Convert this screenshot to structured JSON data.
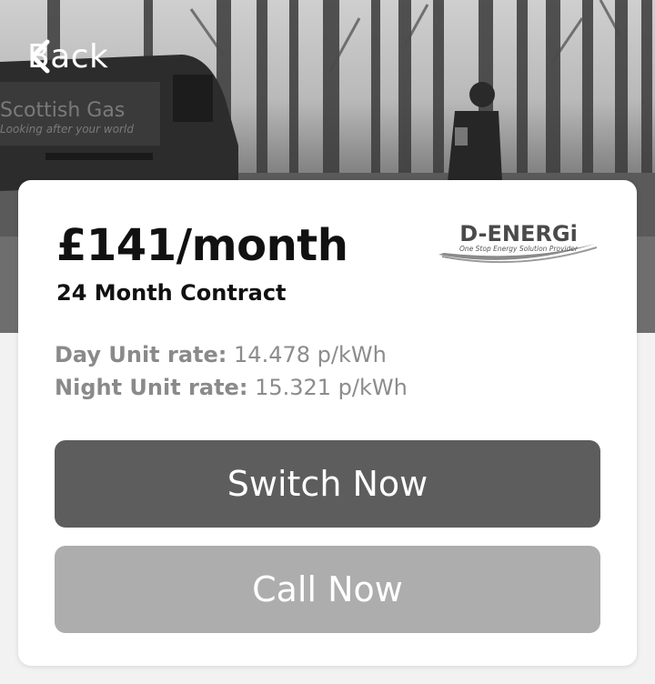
{
  "nav": {
    "back_label": "Back",
    "back_icon": "chevron-left-icon"
  },
  "hero": {
    "van_text_1": "Scottish Gas",
    "van_text_2": "Looking after your world"
  },
  "plan": {
    "price": "£141/month",
    "contract": "24 Month Contract",
    "day_rate_label": "Day Unit rate:",
    "day_rate_value": "14.478 p/kWh",
    "night_rate_label": "Night Unit rate:",
    "night_rate_value": "15.321 p/kWh"
  },
  "supplier_logo": {
    "name": "D-ENERGi",
    "tagline": "One Stop Energy Solution Provider"
  },
  "actions": {
    "switch_label": "Switch Now",
    "call_label": "Call Now"
  },
  "colors": {
    "switch_button": "#5d5d5d",
    "call_button": "#adadad",
    "card_bg": "#ffffff",
    "rate_text": "#8c8c8c"
  }
}
